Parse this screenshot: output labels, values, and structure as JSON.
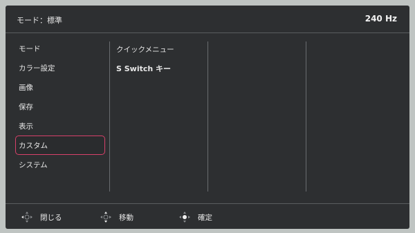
{
  "header": {
    "mode_title": "モード：標準",
    "refresh_rate": "240 Hz"
  },
  "main_menu": {
    "items": [
      {
        "label": "モード"
      },
      {
        "label": "カラー設定"
      },
      {
        "label": "画像"
      },
      {
        "label": "保存"
      },
      {
        "label": "表示"
      },
      {
        "label": "カスタム"
      },
      {
        "label": "システム"
      }
    ],
    "selected": "カスタム"
  },
  "sub_menu": {
    "items": [
      {
        "label": "クイックメニュー"
      },
      {
        "label": "S Switch キー"
      }
    ]
  },
  "footer": {
    "close_label": "閉じる",
    "move_label": "移動",
    "confirm_label": "確定"
  },
  "colors": {
    "panel_bg": "#2d2f31",
    "selection_border": "#d8416a",
    "text": "#e8e8e8"
  },
  "icons": {
    "close": "dpad-left-icon",
    "move": "dpad-updown-icon",
    "confirm": "dpad-center-icon"
  }
}
